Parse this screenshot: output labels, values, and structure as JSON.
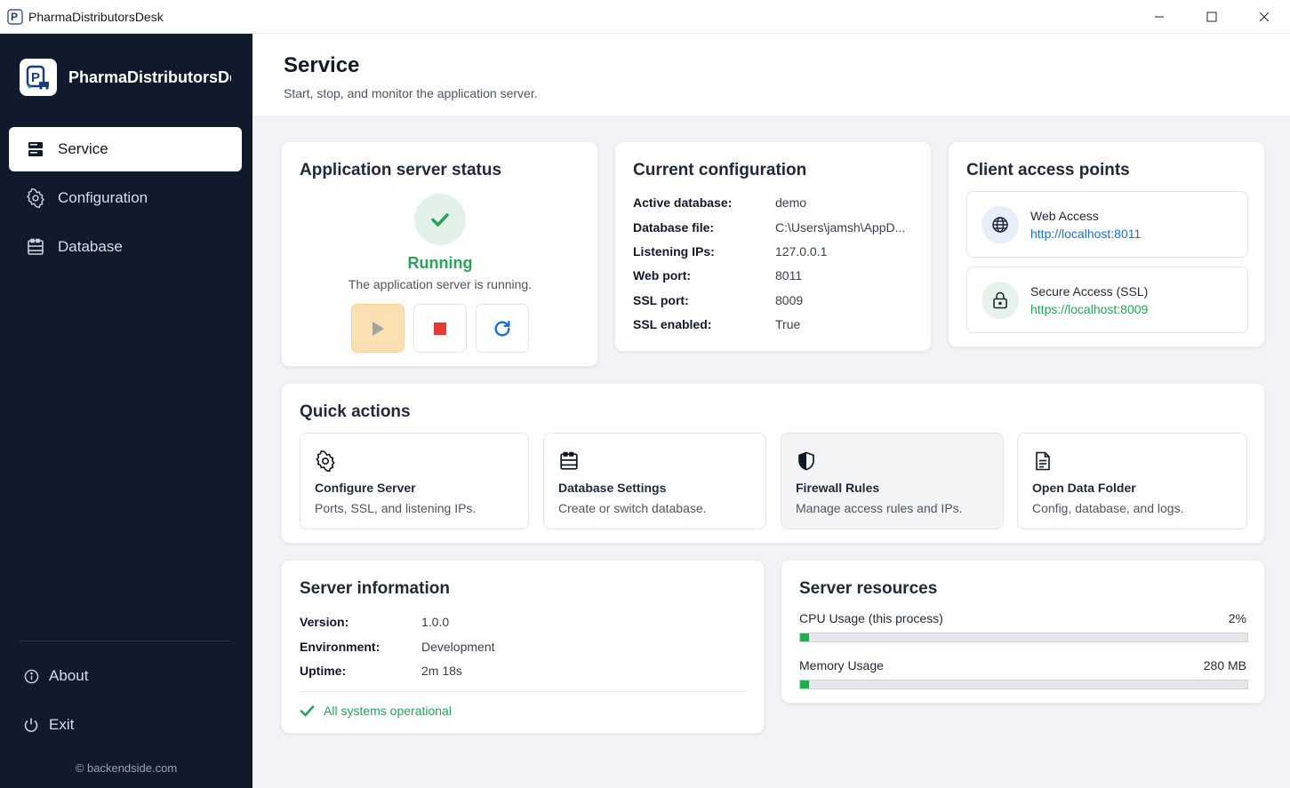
{
  "window": {
    "title": "PharmaDistributorsDesk"
  },
  "sidebar": {
    "brand": "PharmaDistributorsDesk",
    "items": [
      {
        "label": "Service",
        "icon": "server-icon",
        "active": true
      },
      {
        "label": "Configuration",
        "icon": "gear-icon",
        "active": false
      },
      {
        "label": "Database",
        "icon": "database-icon",
        "active": false
      }
    ],
    "about": "About",
    "exit": "Exit",
    "copyright": "© backendside.com"
  },
  "header": {
    "title": "Service",
    "subtitle": "Start, stop, and monitor the application server."
  },
  "status_card": {
    "title": "Application server status",
    "status": "Running",
    "description": "The application server is running."
  },
  "config_card": {
    "title": "Current configuration",
    "rows": [
      {
        "key": "Active database:",
        "value": "demo"
      },
      {
        "key": "Database file:",
        "value": "C:\\Users\\jamsh\\AppD..."
      },
      {
        "key": "Listening IPs:",
        "value": "127.0.0.1"
      },
      {
        "key": "Web port:",
        "value": "8011"
      },
      {
        "key": "SSL port:",
        "value": "8009"
      },
      {
        "key": "SSL enabled:",
        "value": "True"
      }
    ]
  },
  "access_card": {
    "title": "Client access points",
    "items": [
      {
        "label": "Web Access",
        "link": "http://localhost:8011",
        "icon": "globe-icon",
        "color": "#1a6fd6"
      },
      {
        "label": "Secure Access (SSL)",
        "link": "https://localhost:8009",
        "icon": "lock-icon",
        "color": "#27a35a"
      }
    ]
  },
  "quick_actions": {
    "title": "Quick actions",
    "items": [
      {
        "title": "Configure Server",
        "desc": "Ports, SSL, and listening IPs.",
        "icon": "gear-icon"
      },
      {
        "title": "Database Settings",
        "desc": "Create or switch database.",
        "icon": "database-icon"
      },
      {
        "title": "Firewall Rules",
        "desc": "Manage access rules and IPs.",
        "icon": "shield-icon"
      },
      {
        "title": "Open Data Folder",
        "desc": "Config, database, and logs.",
        "icon": "document-icon"
      }
    ]
  },
  "server_info": {
    "title": "Server information",
    "rows": [
      {
        "key": "Version:",
        "value": "1.0.0"
      },
      {
        "key": "Environment:",
        "value": "Development"
      },
      {
        "key": "Uptime:",
        "value": "2m 18s"
      }
    ],
    "operational": "All systems operational"
  },
  "resources": {
    "title": "Server resources",
    "cpu_label": "CPU Usage (this process)",
    "cpu_value": "2%",
    "cpu_fraction": 0.02,
    "mem_label": "Memory Usage",
    "mem_value": "280 MB",
    "mem_fraction": 0.02
  },
  "colors": {
    "sidebar_bg": "#0f1a2c",
    "success": "#27a35a",
    "link": "#1a6fd6",
    "stop": "#e53935",
    "bar_fill": "#16b34a"
  }
}
